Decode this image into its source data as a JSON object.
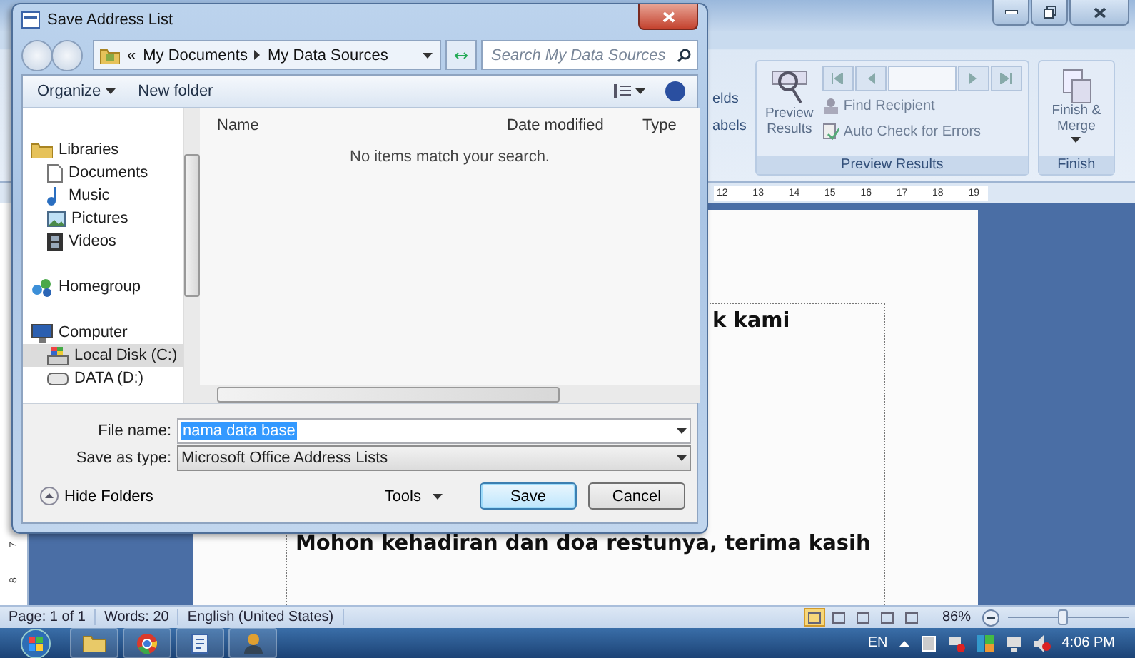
{
  "word": {
    "ribbon": {
      "cut_labels": [
        "elds",
        "abels"
      ],
      "preview_group": {
        "label": "Preview Results",
        "big_button": "Preview Results",
        "actions": [
          {
            "label": "Find Recipient",
            "kind": "find"
          },
          {
            "label": "Auto Check for Errors",
            "kind": "check"
          }
        ]
      },
      "finish_group": {
        "label": "Finish",
        "big_button": "Finish & Merge"
      }
    },
    "ruler": {
      "numbers": [
        "12",
        "13",
        "14",
        "15",
        "16",
        "17",
        "18",
        "19"
      ]
    },
    "vertical_ruler": {
      "numbers": [
        "7",
        "8"
      ]
    },
    "document": {
      "lines": [
        "k kami",
        "Mohon kehadiran dan doa restunya, terima kasih"
      ]
    },
    "status_bar": {
      "page": "Page: 1 of 1",
      "words": "Words: 20",
      "language": "English (United States)",
      "views": [
        {
          "selected": true
        },
        {
          "selected": false
        },
        {
          "selected": false
        },
        {
          "selected": false
        },
        {
          "selected": false
        }
      ],
      "zoom": {
        "reading": "86%",
        "level": 0.45
      }
    }
  },
  "taskbar": {
    "apps": [
      {
        "kind": "explorer"
      },
      {
        "kind": "chrome"
      },
      {
        "kind": "word"
      },
      {
        "kind": "tool"
      }
    ],
    "language": "EN",
    "clock": "4:06 PM"
  },
  "dialog": {
    "title": "Save Address List",
    "breadcrumb_overflow": "«",
    "breadcrumb": [
      "My Documents",
      "My Data Sources"
    ],
    "search": {
      "placeholder": "Search My Data Sources"
    },
    "toolbar": [
      {
        "label": "Organize",
        "dropdown": true
      },
      {
        "label": "New folder",
        "dropdown": false
      }
    ],
    "nav": [
      {
        "label": "Libraries",
        "kind": "libraries",
        "selected": false,
        "children": [
          {
            "label": "Documents",
            "kind": "documents",
            "selected": false
          },
          {
            "label": "Music",
            "kind": "music",
            "selected": false
          },
          {
            "label": "Pictures",
            "kind": "pictures",
            "selected": false
          },
          {
            "label": "Videos",
            "kind": "videos",
            "selected": false
          }
        ]
      },
      {
        "label": "Homegroup",
        "kind": "homegroup",
        "selected": false
      },
      {
        "label": "Computer",
        "kind": "computer",
        "selected": false,
        "children": [
          {
            "label": "Local Disk (C:)",
            "kind": "disk",
            "selected": true
          },
          {
            "label": "DATA (D:)",
            "kind": "drive",
            "selected": false
          }
        ]
      }
    ],
    "columns": [
      "Name",
      "Date modified",
      "Type"
    ],
    "empty_message": "No items match your search.",
    "file_name": {
      "label": "File name:",
      "value": "nama data base"
    },
    "save_type": {
      "label": "Save as type:",
      "value": "Microsoft Office Address Lists"
    },
    "hide_folders": "Hide Folders",
    "tools": "Tools",
    "buttons": [
      {
        "label": "Save",
        "kind": "default"
      },
      {
        "label": "Cancel",
        "kind": "normal"
      }
    ]
  }
}
